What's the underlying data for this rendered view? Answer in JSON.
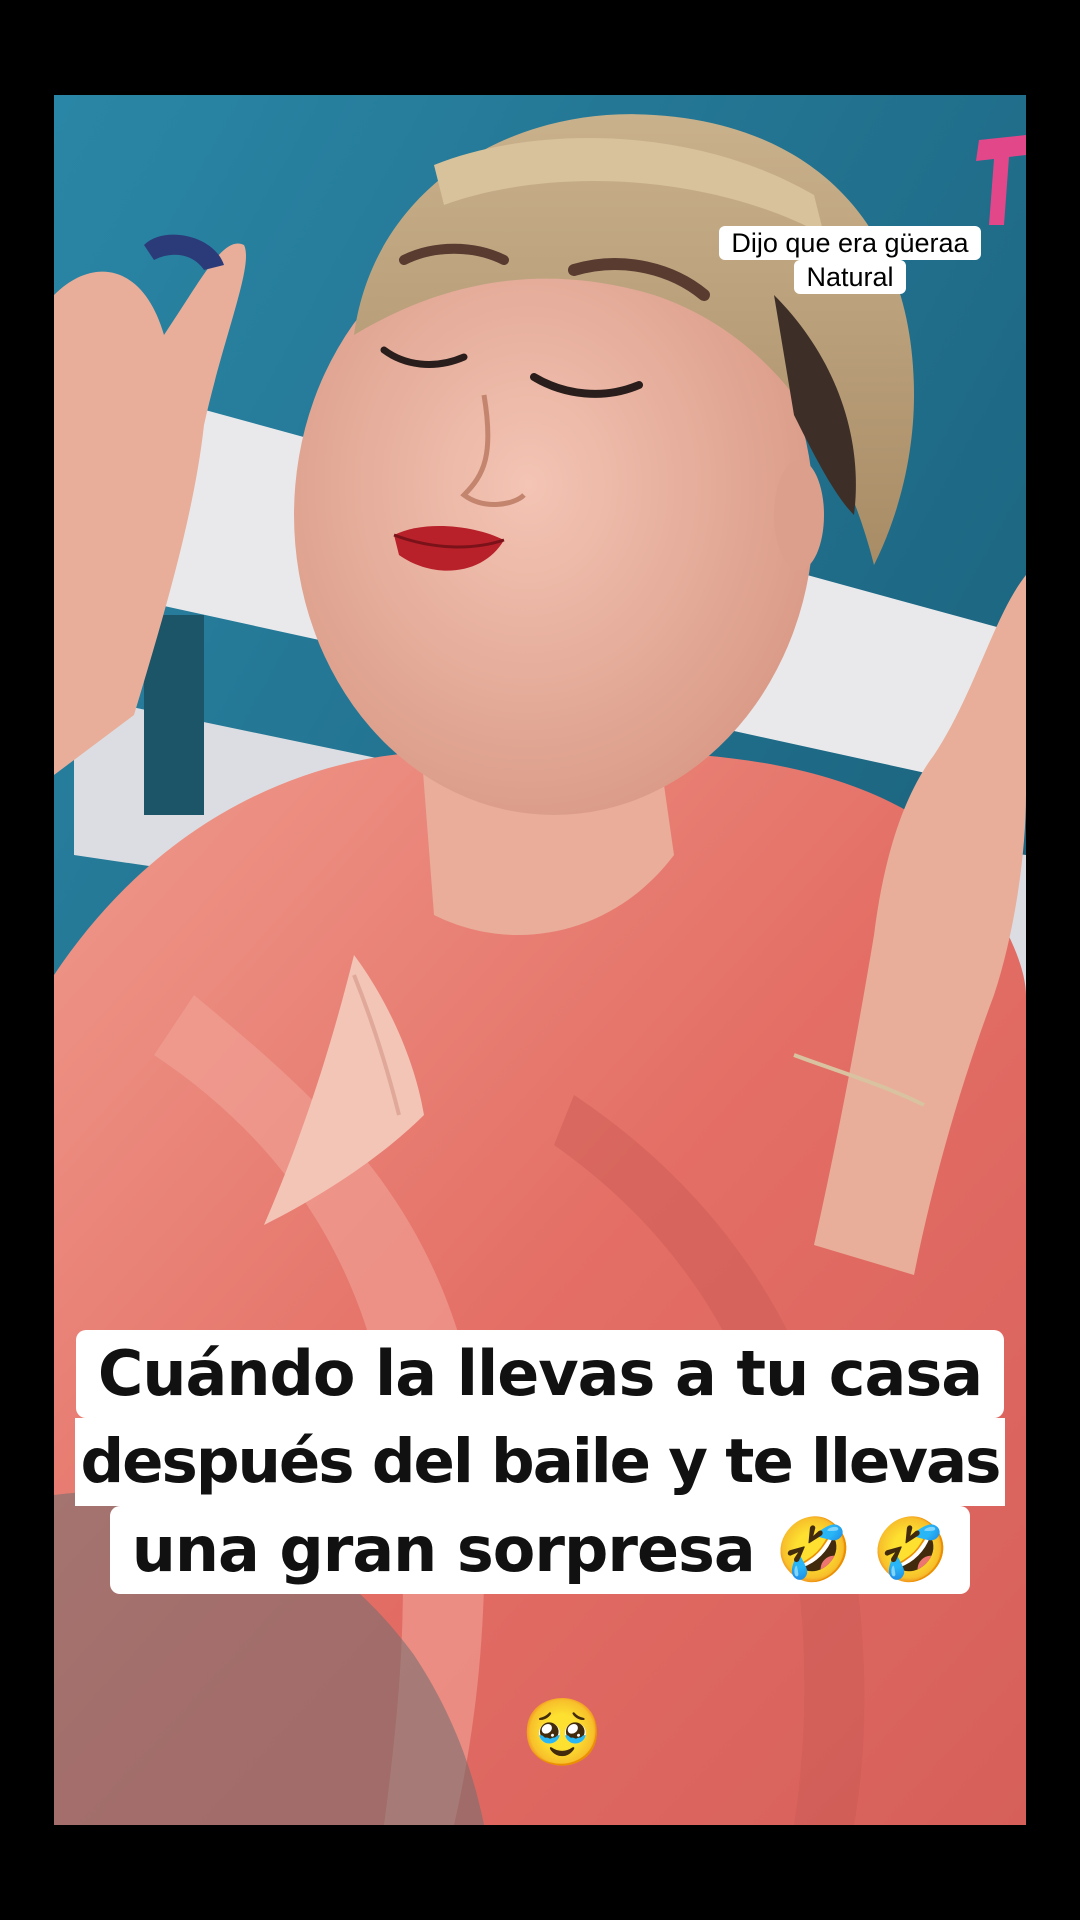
{
  "video": {
    "overlay_caption_small": {
      "line1": "Dijo que era güeraa",
      "line2": "Natural"
    },
    "overlay_caption_main": {
      "line1": "Cuándo la llevas a tu casa",
      "line2": "después del baile y te llevas",
      "line3": "una gran sorpresa 🤣 🤣"
    },
    "bottom_emoji": "🥹"
  },
  "colors": {
    "background": "#000000",
    "wall": "#1d6d8c",
    "robe": "#e77d72",
    "caption_bg": "#ffffff",
    "caption_text": "#111111"
  }
}
